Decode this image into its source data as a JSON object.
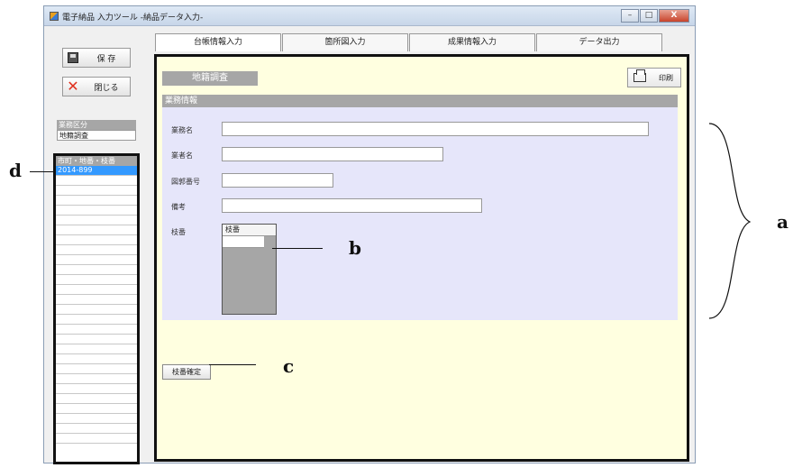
{
  "window": {
    "title": "電子納品 入力ツール -納品データ入力-",
    "controls": {
      "minimize": "–",
      "maximize": "□",
      "close": "X"
    }
  },
  "toolbar": {
    "save_label": "保 存",
    "close_label": "閉じる"
  },
  "category": {
    "header": "業務区分",
    "value": "地籍調査"
  },
  "record_list": {
    "header": "市町・地番・枝番",
    "selected": "2014-899",
    "empty_rows": 27
  },
  "tabs": [
    "台帳情報入力",
    "箇所図入力",
    "成果情報入力",
    "データ出力"
  ],
  "main": {
    "section_title": "地籍調査",
    "print_label": "印刷",
    "info_header": "業務情報",
    "fields": {
      "project_name": {
        "label": "業務名",
        "value": ""
      },
      "company_name": {
        "label": "業者名",
        "value": ""
      },
      "map_number": {
        "label": "図郭番号",
        "value": ""
      },
      "remarks": {
        "label": "備考",
        "value": ""
      },
      "branch": {
        "label": "枝番",
        "column_header": "枝番"
      }
    },
    "confirm_label": "枝番確定"
  },
  "annotations": {
    "a": "a",
    "b": "b",
    "c": "c",
    "d": "d"
  }
}
